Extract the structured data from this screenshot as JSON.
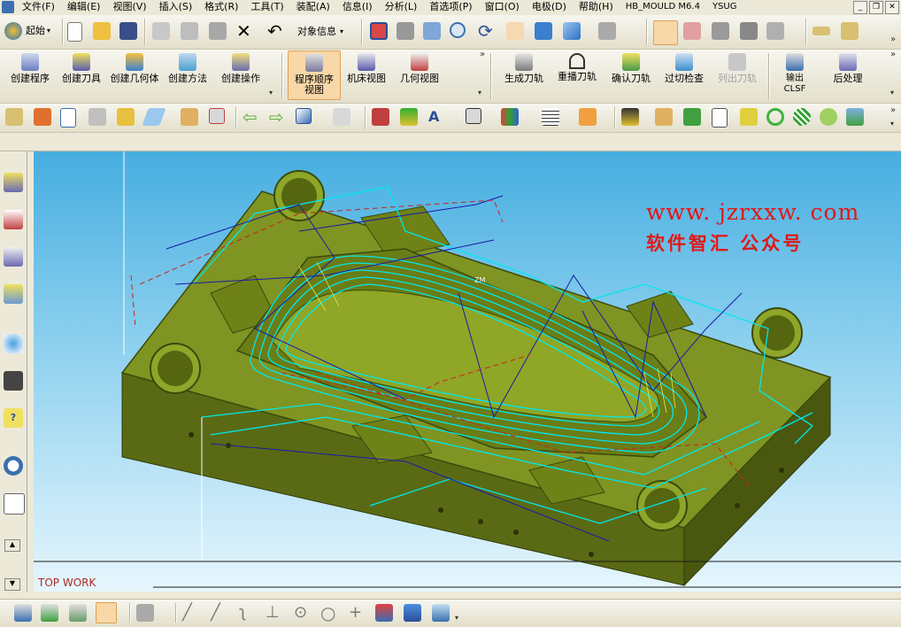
{
  "menu": {
    "items": [
      "文件(F)",
      "编辑(E)",
      "视图(V)",
      "插入(S)",
      "格式(R)",
      "工具(T)",
      "装配(A)",
      "信息(I)",
      "分析(L)",
      "首选项(P)",
      "窗口(O)",
      "电极(D)",
      "帮助(H)",
      "HB_MOULD M6.4",
      "YSUG"
    ]
  },
  "toolbar1": {
    "start_label": "起始",
    "object_info_label": "对象信息"
  },
  "toolbar2": {
    "create_program": "创建程序",
    "create_tool": "创建刀具",
    "create_geometry": "创建几何体",
    "create_method": "创建方法",
    "create_operation": "创建操作",
    "program_order_view": "程序顺序视图",
    "machine_view": "机床视图",
    "geometry_view": "几何视图",
    "generate_toolpath": "生成刀轨",
    "replay_toolpath": "重播刀轨",
    "verify_toolpath": "确认刀轨",
    "gouge_check": "过切检查",
    "list_toolpath": "列出刀轨",
    "output_clsf": "输出CLSF",
    "postprocess": "后处理"
  },
  "viewport": {
    "watermark_url": "www. jzrxxw. com",
    "watermark_text": "软件智汇 公众号",
    "view_name": "TOP WORK",
    "wcs_label": "ZM"
  },
  "colors": {
    "mold_top": "#7f9422",
    "mold_side": "#5a6a14",
    "toolpath_cyan": "#00e8ee",
    "toolpath_blue": "#1a1aa8",
    "dash_red": "#d02020",
    "watermark_red": "#e01818"
  }
}
